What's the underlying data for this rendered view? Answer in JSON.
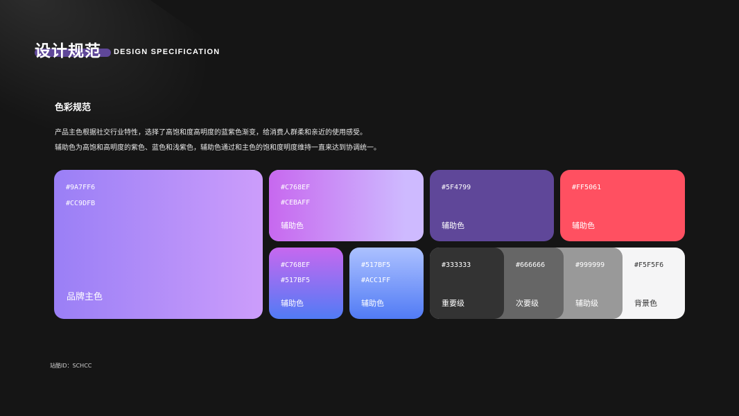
{
  "header": {
    "title": "设计规范",
    "subtitle": "DESIGN SPECIFICATION"
  },
  "section": {
    "title": "色彩规范",
    "desc_line1": "产品主色根据社交行业特性，选择了高饱和度高明度的蓝紫色渐变，给消费人群柔和亲近的使用感受。",
    "desc_line2": "辅助色为高饱和高明度的紫色、蓝色和浅紫色，辅助色通过和主色的饱和度明度维持一直来达到协调统一。"
  },
  "swatches": {
    "brand": {
      "code1": "#9A7FF6",
      "code2": "#CC9DFB",
      "label": "品牌主色"
    },
    "purple": {
      "code1": "#C768EF",
      "code2": "#CEBAFF",
      "label": "辅助色"
    },
    "deep": {
      "code": "#5F4799",
      "label": "辅助色"
    },
    "red": {
      "code": "#FF5061",
      "label": "辅助色"
    },
    "grad1": {
      "code1": "#C768EF",
      "code2": "#517BF5",
      "label": "辅助色"
    },
    "grad2": {
      "code1": "#517BF5",
      "code2": "#ACC1FF",
      "label": "辅助色"
    },
    "gray1": {
      "code": "#333333",
      "label": "重要级"
    },
    "gray2": {
      "code": "#666666",
      "label": "次要级"
    },
    "gray3": {
      "code": "#999999",
      "label": "辅助级"
    },
    "gray4": {
      "code": "#F5F5F6",
      "label": "背景色"
    }
  },
  "colors": {
    "background": "#151515",
    "accent_bar": "#5F4799"
  },
  "footer": {
    "text": "站酷ID：SCHCC"
  }
}
